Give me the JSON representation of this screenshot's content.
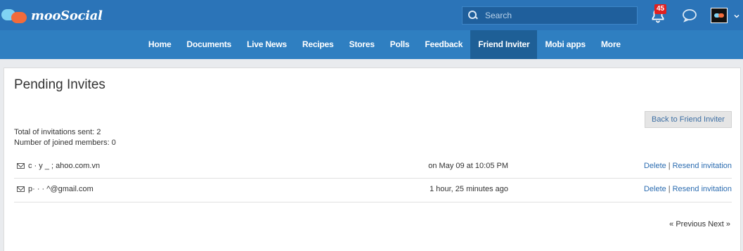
{
  "brand": {
    "name": "mooSocial"
  },
  "search": {
    "placeholder": "Search"
  },
  "header": {
    "notification_count": "45",
    "icons": [
      "bell-icon",
      "chat-icon",
      "avatar",
      "chevron-down-icon"
    ]
  },
  "nav": {
    "items": [
      "Home",
      "Documents",
      "Live News",
      "Recipes",
      "Stores",
      "Polls",
      "Feedback",
      "Friend Inviter",
      "Mobi apps",
      "More"
    ],
    "active": "Friend Inviter"
  },
  "page": {
    "title": "Pending Invites",
    "back_button": "Back to Friend Inviter",
    "total_invitations": "Total of invitations sent: 2",
    "joined_members": "Number of joined members: 0"
  },
  "invites": [
    {
      "email": "c  ·  y   _  ; ahoo.com.vn",
      "time": "on May 09 at 10:05 PM",
      "delete": "Delete",
      "resend": "Resend invitation"
    },
    {
      "email": "p·  ·  ·  ^@gmail.com",
      "time": "1 hour, 25 minutes ago",
      "delete": "Delete",
      "resend": "Resend invitation"
    }
  ],
  "pagination": {
    "previous": "« Previous",
    "next": "Next »"
  },
  "colors": {
    "topbar": "#2b74b8",
    "navbar": "#2f7fc1",
    "nav_active": "#1e5f96",
    "link": "#2b6cb0",
    "badge": "#e02020"
  }
}
